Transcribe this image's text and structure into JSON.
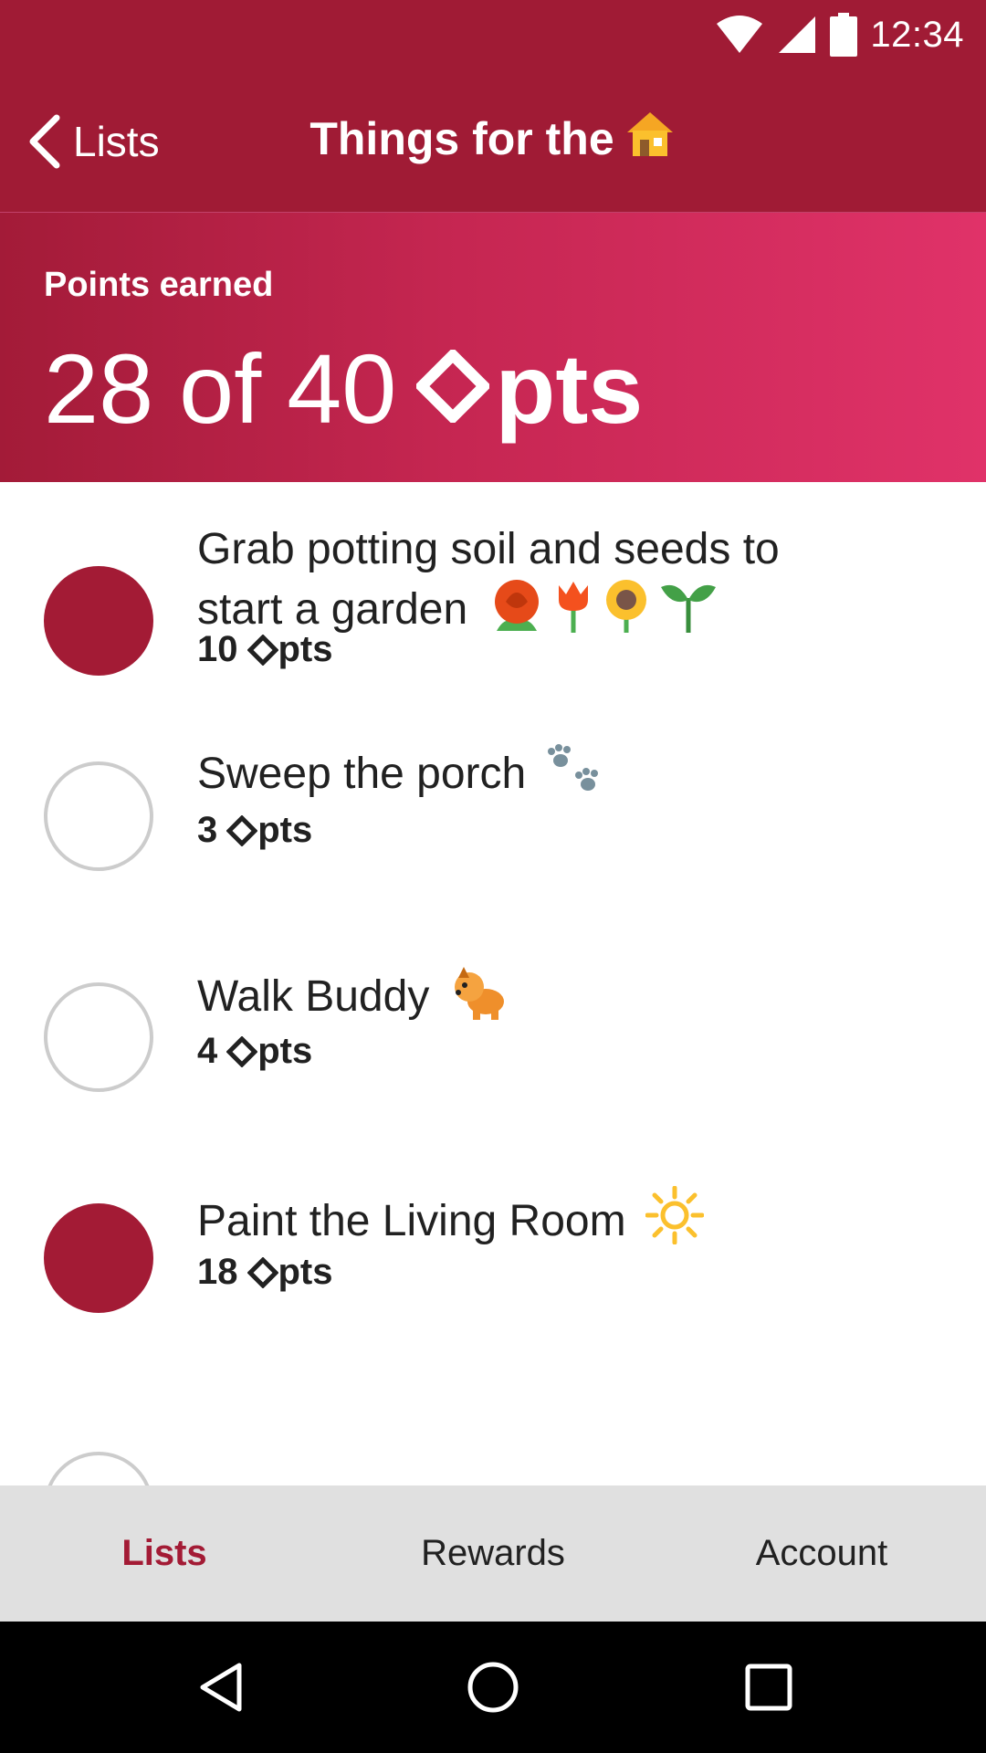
{
  "status_bar": {
    "time": "12:34"
  },
  "app_bar": {
    "back_label": "Lists",
    "title": "Things for the"
  },
  "banner": {
    "caption": "Points earned",
    "earned": "28",
    "of": "of",
    "total": "40",
    "unit": "pts"
  },
  "items": [
    {
      "line1": "Grab potting soil and seeds to",
      "line2": "start a garden",
      "points": "10",
      "unit": "pts",
      "completed": true
    },
    {
      "line1": "Sweep the porch",
      "points": "3",
      "unit": "pts",
      "completed": false
    },
    {
      "line1": "Walk Buddy",
      "points": "4",
      "unit": "pts",
      "completed": false
    },
    {
      "line1": "Paint the Living Room",
      "points": "18",
      "unit": "pts",
      "completed": true
    }
  ],
  "tabs": [
    {
      "label": "Lists",
      "active": true
    },
    {
      "label": "Rewards",
      "active": false
    },
    {
      "label": "Account",
      "active": false
    }
  ],
  "colors": {
    "primary": "#a01b35",
    "accent": "#e03269",
    "tab_bg": "#e0e0e0"
  },
  "icons": [
    "wifi-icon",
    "signal-icon",
    "battery-icon",
    "chevron-left-icon",
    "house-icon",
    "diamond-icon",
    "rose-icon",
    "tulip-icon",
    "sunflower-icon",
    "seedling-icon",
    "paw-prints-icon",
    "dog-icon",
    "sun-icon",
    "back-nav-icon",
    "home-nav-icon",
    "recents-nav-icon"
  ]
}
